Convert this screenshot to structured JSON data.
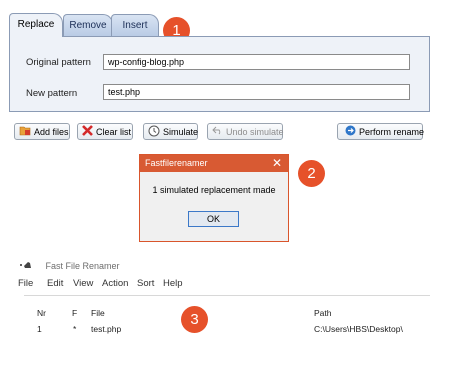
{
  "panel1": {
    "tabs": [
      {
        "label": "Replace",
        "active": true
      },
      {
        "label": "Remove",
        "active": false
      },
      {
        "label": "Insert",
        "active": false
      }
    ],
    "fields": {
      "original_label": "Original pattern",
      "original_value": "wp-config-blog.php",
      "new_label": "New pattern",
      "new_value": "test.php"
    },
    "buttons": {
      "add_files": "Add files",
      "clear_list": "Clear list",
      "simulate": "Simulate",
      "undo_simulate": "Undo simulate",
      "perform_rename": "Perform rename"
    },
    "badge": "1"
  },
  "dialog": {
    "title": "Fastfilerenamer",
    "message": "1 simulated replacement made",
    "ok_label": "OK",
    "badge": "2"
  },
  "panel3": {
    "app_title": "Fast File Renamer",
    "menu": [
      "File",
      "Edit",
      "View",
      "Action",
      "Sort",
      "Help"
    ],
    "columns": {
      "nr": "Nr",
      "f": "F",
      "file": "File",
      "path": "Path"
    },
    "rows": [
      {
        "nr": "1",
        "f": "*",
        "file": "test.php",
        "path": "C:\\Users\\HBS\\Desktop\\"
      }
    ],
    "badge": "3"
  },
  "colors": {
    "badge": "#e6512a",
    "dialog_title": "#d85a33",
    "tab_panel": "#eef2f8"
  },
  "icons": [
    "add-files-icon",
    "clear-list-icon",
    "simulate-icon",
    "undo-icon",
    "perform-rename-icon",
    "close-icon",
    "app-icon"
  ]
}
